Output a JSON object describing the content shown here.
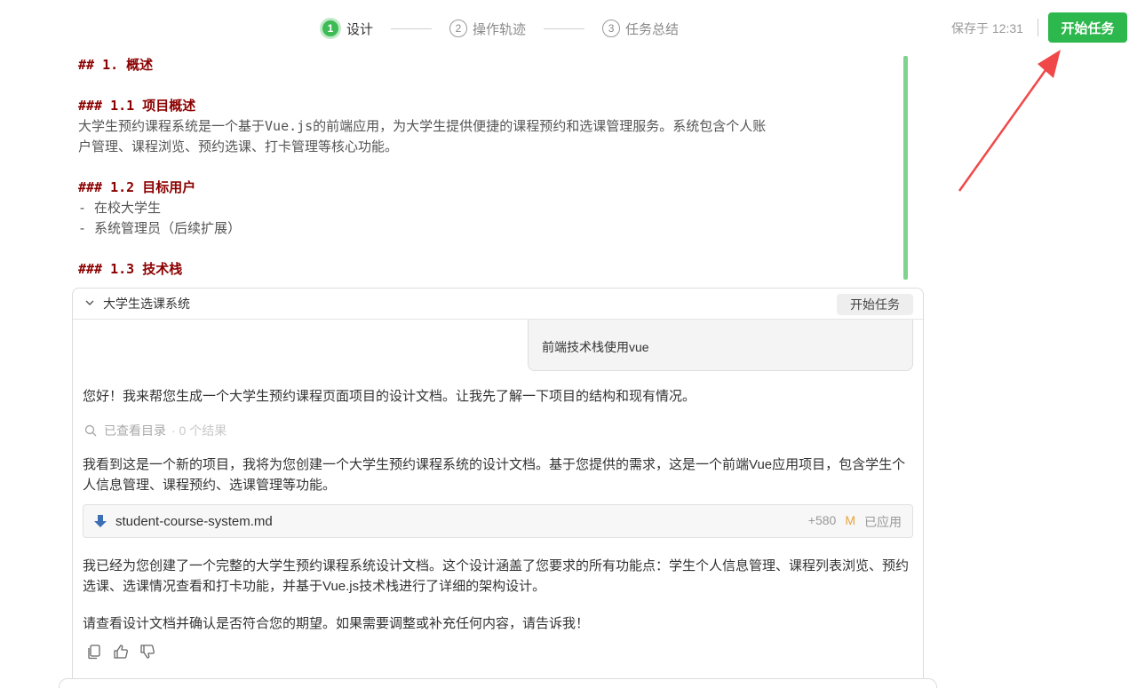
{
  "steps": [
    {
      "num": "1",
      "label": "设计"
    },
    {
      "num": "2",
      "label": "操作轨迹"
    },
    {
      "num": "3",
      "label": "任务总结"
    }
  ],
  "header": {
    "saved_text": "保存于 12:31",
    "start_button": "开始任务"
  },
  "doc": {
    "h1": "## 1. 概述",
    "h2_1": "### 1.1 项目概述",
    "p1_line1": "大学生预约课程系统是一个基于Vue.js的前端应用，为大学生提供便捷的课程预约和选课管理服务。系统包含个人账",
    "p1_line2": "户管理、课程浏览、预约选课、打卡管理等核心功能。",
    "h2_2": "### 1.2 目标用户",
    "li1": "- 在校大学生",
    "li2": "- 系统管理员（后续扩展）",
    "h2_3_partial": "### 1.3 技术栈"
  },
  "panel": {
    "title": "大学生选课系统",
    "start_button": "开始任务",
    "user_message": "前端技术栈使用vue",
    "msg1": "您好！我来帮您生成一个大学生预约课程页面项目的设计文档。让我先了解一下项目的结构和现有情况。",
    "search_label": "已查看目录",
    "search_result": "· 0 个结果",
    "msg2": "我看到这是一个新的项目，我将为您创建一个大学生预约课程系统的设计文档。基于您提供的需求，这是一个前端Vue应用项目，包含学生个人信息管理、课程预约、选课管理等功能。",
    "file": {
      "name": "student-course-system.md",
      "added": "+580",
      "status_letter": "M",
      "status": "已应用"
    },
    "msg3": "我已经为您创建了一个完整的大学生预约课程系统设计文档。这个设计涵盖了您要求的所有功能点：学生个人信息管理、课程列表浏览、预约选课、选课情况查看和打卡功能，并基于Vue.js技术栈进行了详细的架构设计。",
    "msg4": "请查看设计文档并确认是否符合您的期望。如果需要调整或补充任何内容，请告诉我！"
  },
  "colors": {
    "accent_green": "#2db84d",
    "heading_red": "#8b0000",
    "annotation_red": "#f04848"
  }
}
